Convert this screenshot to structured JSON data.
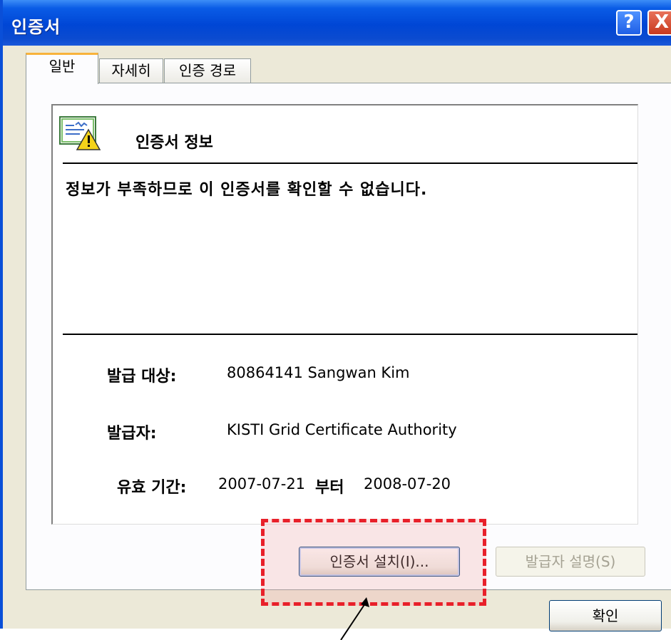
{
  "window": {
    "title": "인증서",
    "help_label": "?",
    "close_label": "X",
    "colors": {
      "titlebar": "#0046d5",
      "face": "#ece9d8",
      "highlight": "#e8202a"
    }
  },
  "tabs": [
    {
      "label": "일반",
      "active": true
    },
    {
      "label": "자세히",
      "active": false
    },
    {
      "label": "인증 경로",
      "active": false
    }
  ],
  "info": {
    "icon": "certificate-warning-icon",
    "title": "인증서 정보",
    "message": "정보가 부족하므로 이 인증서를 확인할 수 없습니다.",
    "issued_to_label": "발급 대상:",
    "issued_to_value": "80864141 Sangwan Kim",
    "issued_by_label": "발급자:",
    "issued_by_value": "KISTI Grid Certificate Authority",
    "validity_label": "유효 기간:",
    "valid_from": "2007-07-21",
    "validity_connector": "부터",
    "valid_to": "2008-07-20"
  },
  "buttons": {
    "install": "인증서 설치(I)...",
    "issuer_statement": "발급자 설명(S)",
    "ok": "확인"
  }
}
